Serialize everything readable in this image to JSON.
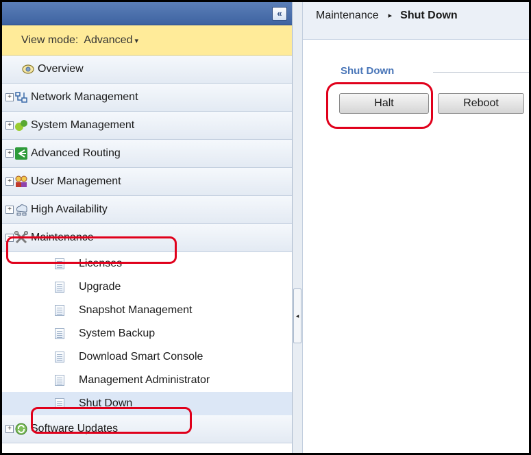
{
  "sidebar": {
    "collapse_glyph": "«",
    "view_mode": {
      "label": "View mode:",
      "value": "Advanced",
      "caret": "▾"
    },
    "items": [
      {
        "label": "Overview",
        "icon": "overview-icon"
      },
      {
        "label": "Network Management",
        "icon": "network-icon"
      },
      {
        "label": "System Management",
        "icon": "system-management-icon"
      },
      {
        "label": "Advanced Routing",
        "icon": "routing-icon"
      },
      {
        "label": "User Management",
        "icon": "users-icon"
      },
      {
        "label": "High Availability",
        "icon": "high-availability-icon"
      },
      {
        "label": "Maintenance",
        "icon": "tools-icon"
      }
    ],
    "maintenance_subitems": [
      "Licenses",
      "Upgrade",
      "Snapshot Management",
      "System Backup",
      "Download Smart Console",
      "Management Administrator",
      "Shut Down"
    ],
    "last_item": {
      "label": "Software Updates",
      "icon": "software-updates-icon"
    },
    "expander_plus": "+",
    "expander_minus": "−"
  },
  "splitter": {
    "glyph": "◂"
  },
  "main": {
    "breadcrumb": {
      "parent": "Maintenance",
      "sep": "▸",
      "current": "Shut Down"
    },
    "section_title": "Shut Down",
    "buttons": {
      "halt": "Halt",
      "reboot": "Reboot"
    }
  },
  "colors": {
    "annotation": "#e0001b",
    "header": "#4a6fae",
    "view_mode_bg": "#ffeb99",
    "section_title": "#4a76b8"
  }
}
